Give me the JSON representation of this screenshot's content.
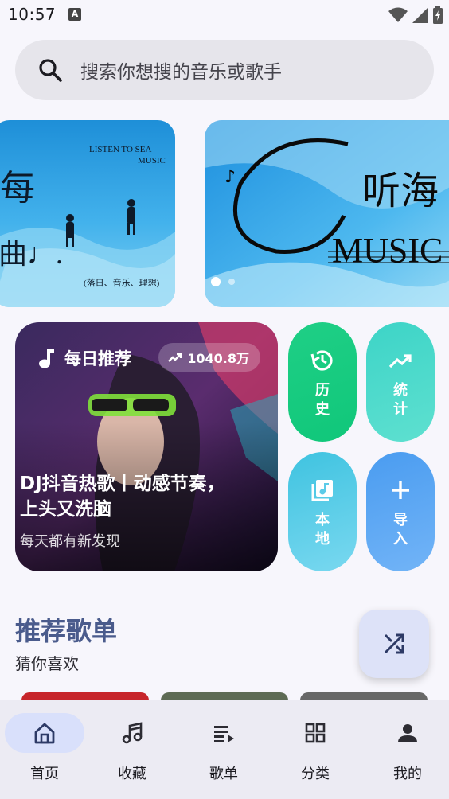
{
  "status_bar": {
    "time": "10:57",
    "indicator": "A"
  },
  "search": {
    "placeholder": "搜索你想搜的音乐或歌手"
  },
  "banners": [
    {
      "texts": [
        "LISTEN TO SEA",
        "MUSIC",
        "(落日、音乐、理想)"
      ]
    },
    {
      "texts": [
        "听海",
        "MUSIC"
      ]
    }
  ],
  "daily": {
    "title": "每日推荐",
    "play_count": "1040.8万",
    "song": "DJ抖音热歌丨动感节奏，上头又洗脑",
    "subtitle": "每天都有新发现"
  },
  "quick_tiles": [
    {
      "label": "历史",
      "icon": "history-icon",
      "color": "#10c77a"
    },
    {
      "label": "统计",
      "icon": "trending-up-icon",
      "color": "#3dd4c7"
    },
    {
      "label": "本地",
      "icon": "library-music-icon",
      "color": "#3fc3e0"
    },
    {
      "label": "导入",
      "icon": "plus-icon",
      "color": "#4a9cf0"
    }
  ],
  "section": {
    "title": "推荐歌单",
    "subtitle": "猜你喜欢"
  },
  "fab": {
    "icon": "shuffle-icon"
  },
  "nav": [
    {
      "label": "首页",
      "icon": "home-icon",
      "active": true
    },
    {
      "label": "收藏",
      "icon": "music-note-icon",
      "active": false
    },
    {
      "label": "歌单",
      "icon": "playlist-icon",
      "active": false
    },
    {
      "label": "分类",
      "icon": "grid-icon",
      "active": false
    },
    {
      "label": "我的",
      "icon": "person-icon",
      "active": false
    }
  ],
  "colors": {
    "accent": "#4a5b8c",
    "nav_active_pill": "#d9e0fb",
    "background": "#f7f6fc"
  }
}
